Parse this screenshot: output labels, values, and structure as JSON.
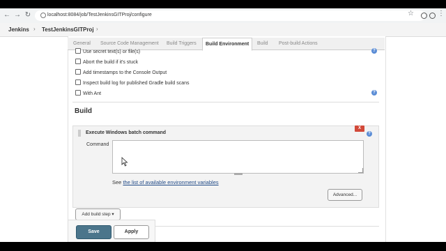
{
  "browser": {
    "url": "localhost:8084/job/TestJenkinsGITProj/configure",
    "icons": [
      "back-arrow-icon",
      "forward-arrow-icon",
      "reload-icon",
      "lock-icon",
      "star-icon",
      "extension-icon",
      "profile-icon",
      "menu-icon"
    ]
  },
  "breadcrumbs": [
    "Jenkins",
    "TestJenkinsGITProj"
  ],
  "tabs": [
    "General",
    "Source Code Management",
    "Build Triggers",
    "Build Environment",
    "Build",
    "Post-build Actions"
  ],
  "active_tab": "Build Environment",
  "build_env": {
    "options": [
      "Use secret text(s) or file(s)",
      "Abort the build if it's stuck",
      "Add timestamps to the Console Output",
      "Inspect build log for published Gradle build scans",
      "With Ant"
    ]
  },
  "build": {
    "title": "Build",
    "step_title": "Execute Windows batch command",
    "delete_label": "X",
    "command_label": "Command",
    "command_value": "",
    "see_prefix": "See",
    "see_link": "the list of available environment variables",
    "advanced_label": "Advanced...",
    "add_step_label": "Add build step"
  },
  "footer": {
    "save_label": "Save",
    "apply_label": "Apply"
  }
}
